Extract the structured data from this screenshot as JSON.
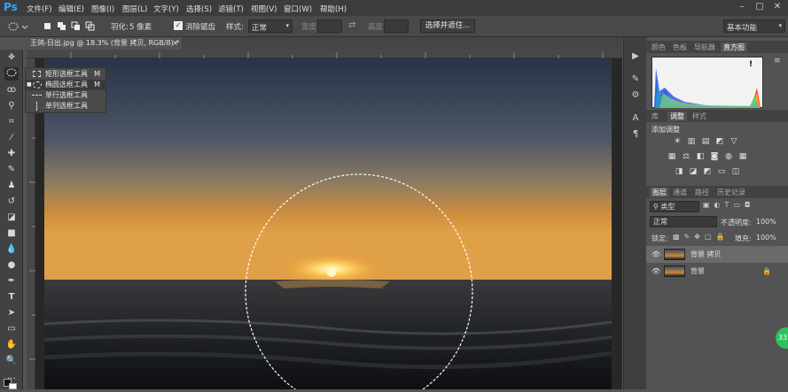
{
  "app": {
    "logo": "Ps"
  },
  "menubar": {
    "items": [
      "文件(F)",
      "编辑(E)",
      "图像(I)",
      "图层(L)",
      "文字(Y)",
      "选择(S)",
      "滤镜(T)",
      "视图(V)",
      "窗口(W)",
      "帮助(H)"
    ],
    "min": "–",
    "max": "□",
    "close": "✕"
  },
  "options": {
    "feather_label": "羽化:",
    "feather_value": "5 像素",
    "antialias_label": "消除锯齿",
    "style_label": "样式:",
    "style_value": "正常",
    "width_label": "宽度:",
    "height_label": "高度:",
    "select_mask_button": "选择并遮住...",
    "workspace": "基本功能"
  },
  "document": {
    "tab_title": "王鸽-日出.jpg @ 18.3% (背景 拷贝, RGB/8) *",
    "close": "×"
  },
  "flyout": {
    "items": [
      {
        "label": "矩形选框工具",
        "key": "M"
      },
      {
        "label": "椭圆选框工具",
        "key": "M"
      },
      {
        "label": "单行选框工具",
        "key": ""
      },
      {
        "label": "单列选框工具",
        "key": ""
      }
    ]
  },
  "panel_top": {
    "tabs": [
      "颜色",
      "色板",
      "导航器",
      "直方图"
    ],
    "active": "直方图",
    "warning": "!"
  },
  "panel_adjust": {
    "tabs": [
      "库",
      "调整",
      "样式"
    ],
    "active": "调整",
    "title": "添加调整"
  },
  "panel_layers": {
    "tabs": [
      "图层",
      "通道",
      "路径",
      "历史记录"
    ],
    "active": "图层",
    "filter_kind": "类型",
    "blend_mode": "正常",
    "opacity_label": "不透明度:",
    "opacity_value": "100%",
    "lock_label": "锁定:",
    "fill_label": "填充:",
    "fill_value": "100%",
    "layers": [
      {
        "name": "背景 拷贝",
        "selected": true,
        "locked": false
      },
      {
        "name": "背景",
        "selected": false,
        "locked": true
      }
    ]
  },
  "badge": "33"
}
